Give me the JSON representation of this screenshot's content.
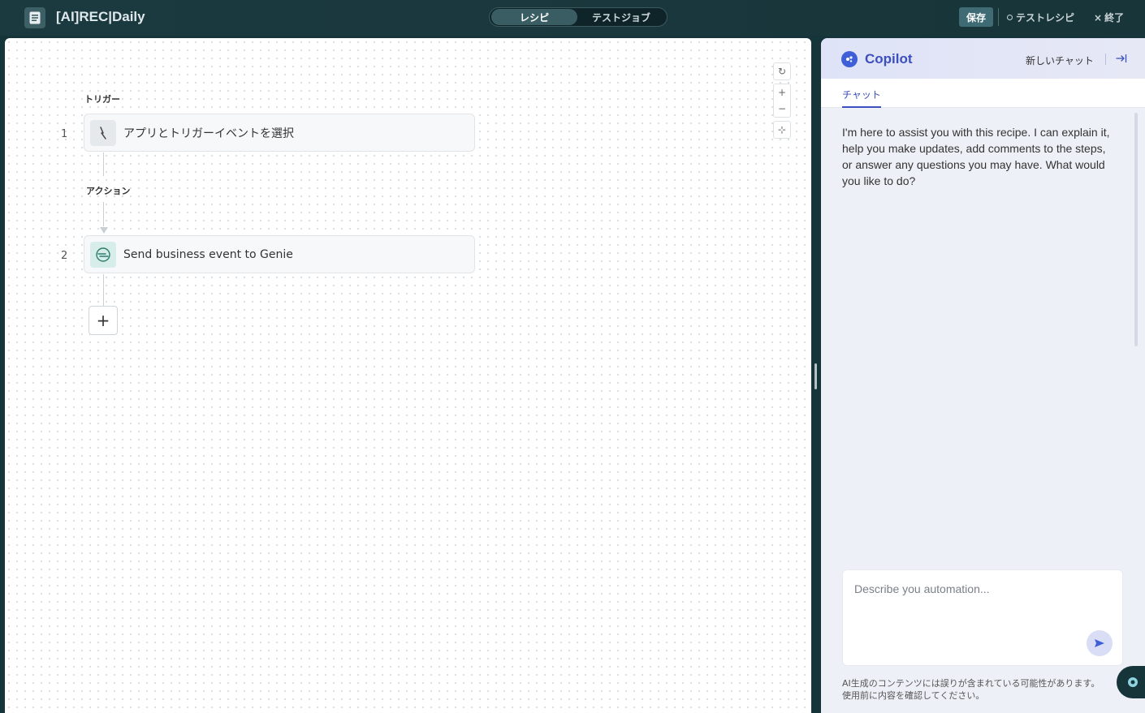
{
  "header": {
    "recipe_title": "[AI]REC|Daily",
    "modes": [
      "レシピ",
      "テストジョブ"
    ],
    "save_label": "保存",
    "test_recipe_label": "テストレシピ",
    "exit_label": "終了"
  },
  "canvas": {
    "trigger_label": "トリガー",
    "action_label": "アクション",
    "steps": [
      {
        "number": "1",
        "label": "アプリとトリガーイベントを選択",
        "icon": "trigger-icon"
      },
      {
        "number": "2",
        "label": "Send business event to Genie",
        "icon": "genie-icon"
      }
    ],
    "add_step": "+",
    "zoom_controls": {
      "reset": "↻",
      "zoom_in": "+",
      "zoom_out": "−",
      "fit": "⊹"
    }
  },
  "copilot": {
    "title": "Copilot",
    "new_chat_label": "新しいチャット",
    "tab_label": "チャット",
    "message": "I'm here to assist you with this recipe. I can explain it, help you make updates, add comments to the steps, or answer any questions you may have. What would you like to do?",
    "input_placeholder": "Describe you automation...",
    "disclaimer_line1": "AI生成のコンテンツには誤りが含まれている可能性があります。",
    "disclaimer_line2": "使用前に内容を確認してください。"
  },
  "colors": {
    "topbar": "#1b3a40",
    "accent": "#3b4fbf",
    "save": "#3f6c74"
  }
}
